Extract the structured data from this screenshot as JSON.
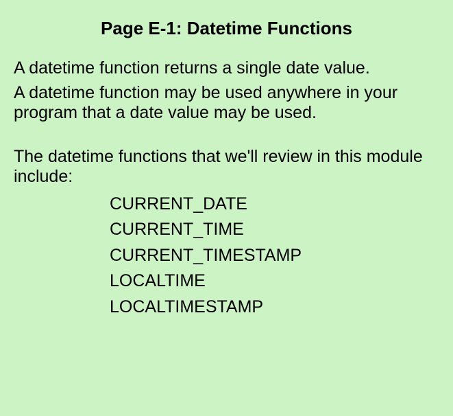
{
  "title": "Page E-1: Datetime Functions",
  "paragraphs": {
    "p1": "A datetime function returns a single date value.",
    "p2": "A datetime function may be used anywhere in your program that a date value may be used."
  },
  "intro": "The datetime functions that we'll review in this module include:",
  "functions": [
    "CURRENT_DATE",
    "CURRENT_TIME",
    "CURRENT_TIMESTAMP",
    "LOCALTIME",
    "LOCALTIMESTAMP"
  ]
}
